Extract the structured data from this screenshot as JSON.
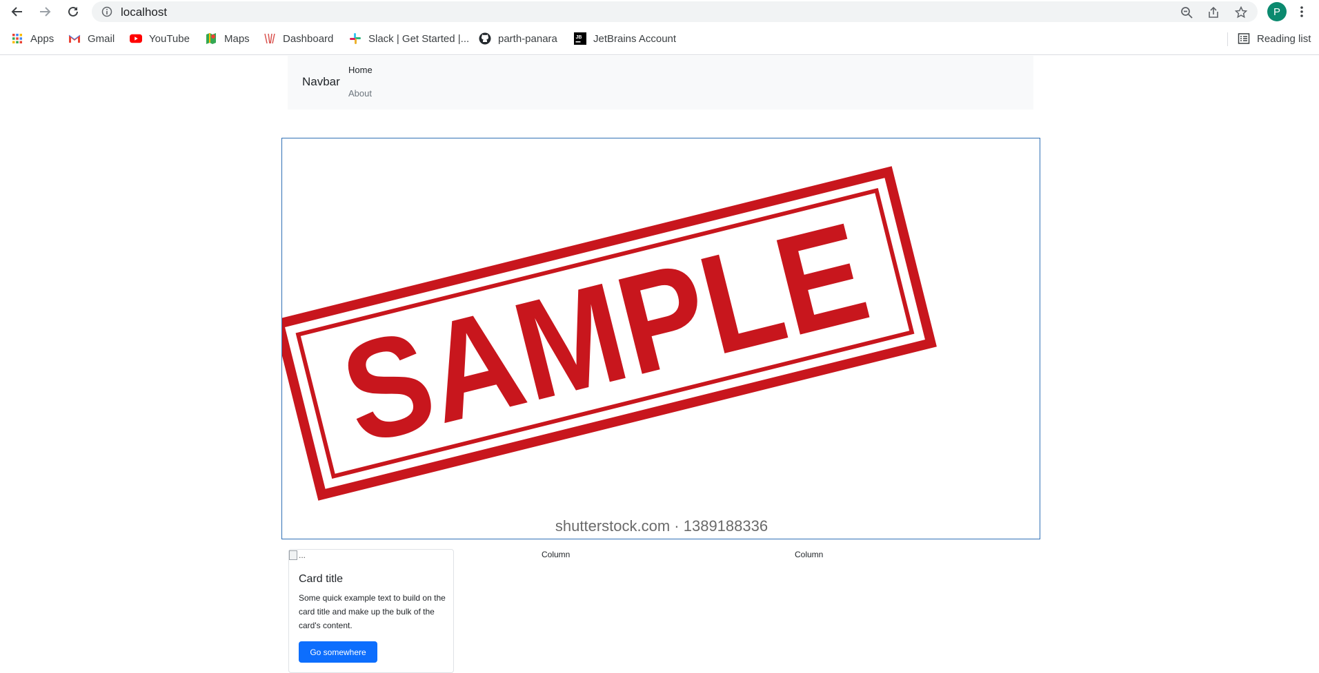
{
  "browser": {
    "url": "localhost",
    "profile_initial": "P",
    "bookmarks": [
      {
        "label": "Apps",
        "icon": "apps-grid-icon"
      },
      {
        "label": "Gmail",
        "icon": "gmail-icon"
      },
      {
        "label": "YouTube",
        "icon": "youtube-icon"
      },
      {
        "label": "Maps",
        "icon": "maps-icon"
      },
      {
        "label": "Dashboard",
        "icon": "dashboard-icon"
      },
      {
        "label": "Slack | Get Started |...",
        "icon": "slack-icon"
      },
      {
        "label": "parth-panara",
        "icon": "github-icon"
      },
      {
        "label": "JetBrains Account",
        "icon": "jetbrains-icon"
      }
    ],
    "reading_list": "Reading list"
  },
  "navbar": {
    "brand": "Navbar",
    "links": [
      "Home",
      "About"
    ]
  },
  "hero": {
    "stamp_text": "SAMPLE",
    "watermark": "shutterstock.com · 1389188336"
  },
  "card": {
    "image_alt": "...",
    "title": "Card title",
    "text": "Some quick example text to build on the card title and make up the bulk of the card's content.",
    "button": "Go somewhere"
  },
  "columns": [
    "Column",
    "Column"
  ],
  "colors": {
    "primary": "#0d6efd",
    "stamp_red": "#c8161d",
    "navbar_bg": "#f8f9fa",
    "profile": "#0b8a6f"
  }
}
